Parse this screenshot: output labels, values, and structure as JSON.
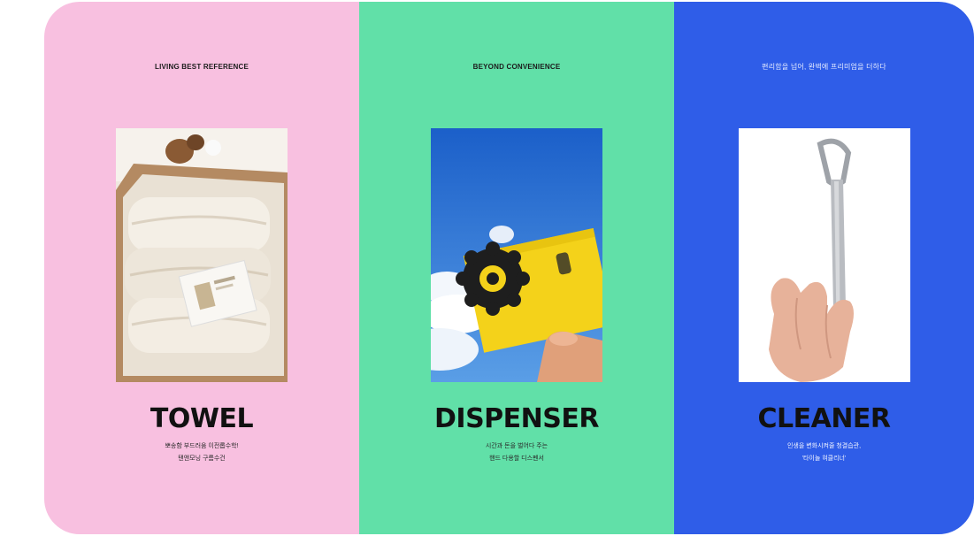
{
  "panels": [
    {
      "id": "towel",
      "tagline": "LIVING BEST REFERENCE",
      "name": "TOWEL",
      "desc": [
        "뽀송함 부드러움 이전롭수학!",
        "탠앤모닝 구름수건"
      ],
      "bg": "#f8c0e0",
      "photo": "folded-towels-photo"
    },
    {
      "id": "dispenser",
      "tagline": "BEYOND CONVENIENCE",
      "name": "DISPENSER",
      "desc": [
        "시간과 돈을 벌어다 주는",
        "핸드 다용할 디스펜서"
      ],
      "bg": "#61e0a8",
      "photo": "yellow-dispenser-photo"
    },
    {
      "id": "cleaner",
      "tagline": "편리함을 넘어, 완벽에 프리미엄을 더하다",
      "name": "CLEANER",
      "desc": [
        "인생을 변화시켜줄 청결습관,",
        "'타이놀 혀클리너'"
      ],
      "bg": "#2f5de8",
      "photo": "tongue-cleaner-photo"
    }
  ]
}
